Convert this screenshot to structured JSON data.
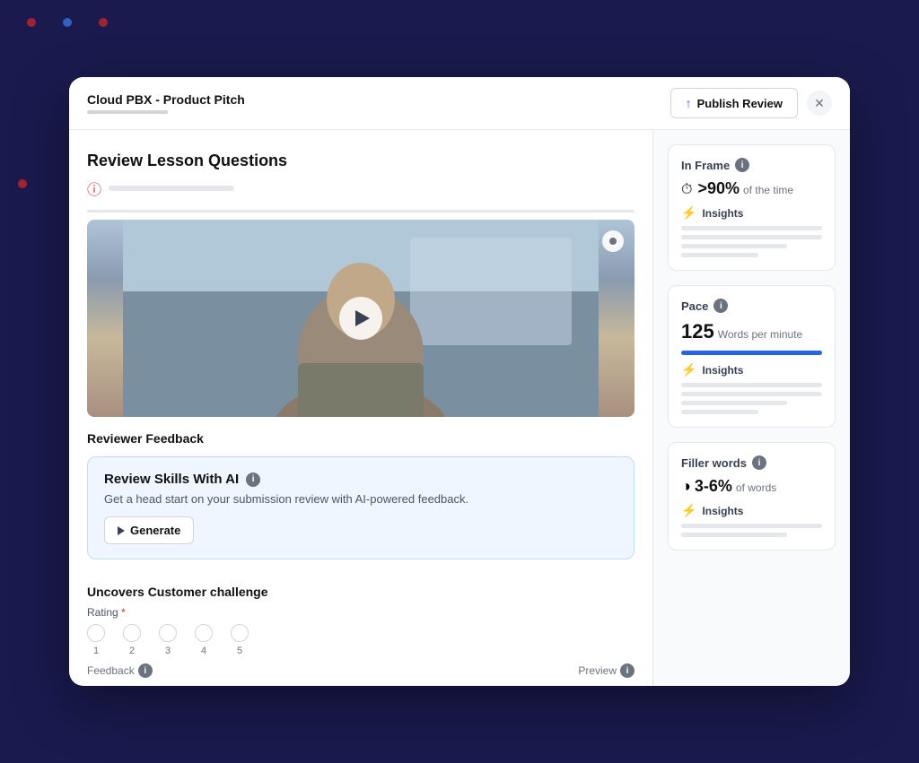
{
  "header": {
    "title": "Cloud PBX - Product Pitch",
    "publish_label": "Publish Review",
    "close_label": "✕"
  },
  "main": {
    "section_title": "Review Lesson Questions",
    "reviewer_feedback_label": "Reviewer Feedback",
    "ai_review": {
      "title": "Review Skills With AI",
      "description": "Get a head start on your submission review with AI-powered feedback.",
      "generate_label": "Generate"
    },
    "customer_section": {
      "title": "Uncovers Customer challenge",
      "rating_label": "Rating",
      "rating_numbers": [
        "1",
        "2",
        "3",
        "4",
        "5"
      ],
      "feedback_label": "Feedback",
      "preview_label": "Preview"
    }
  },
  "right_panel": {
    "in_frame": {
      "name": "In Frame",
      "value": ">90%",
      "suffix": "of the time",
      "insights_label": "Insights"
    },
    "pace": {
      "name": "Pace",
      "value": "125",
      "suffix": "Words per minute",
      "insights_label": "Insights"
    },
    "filler_words": {
      "name": "Filler words",
      "value": "3-6%",
      "suffix": "of words",
      "insights_label": "Insights"
    }
  }
}
